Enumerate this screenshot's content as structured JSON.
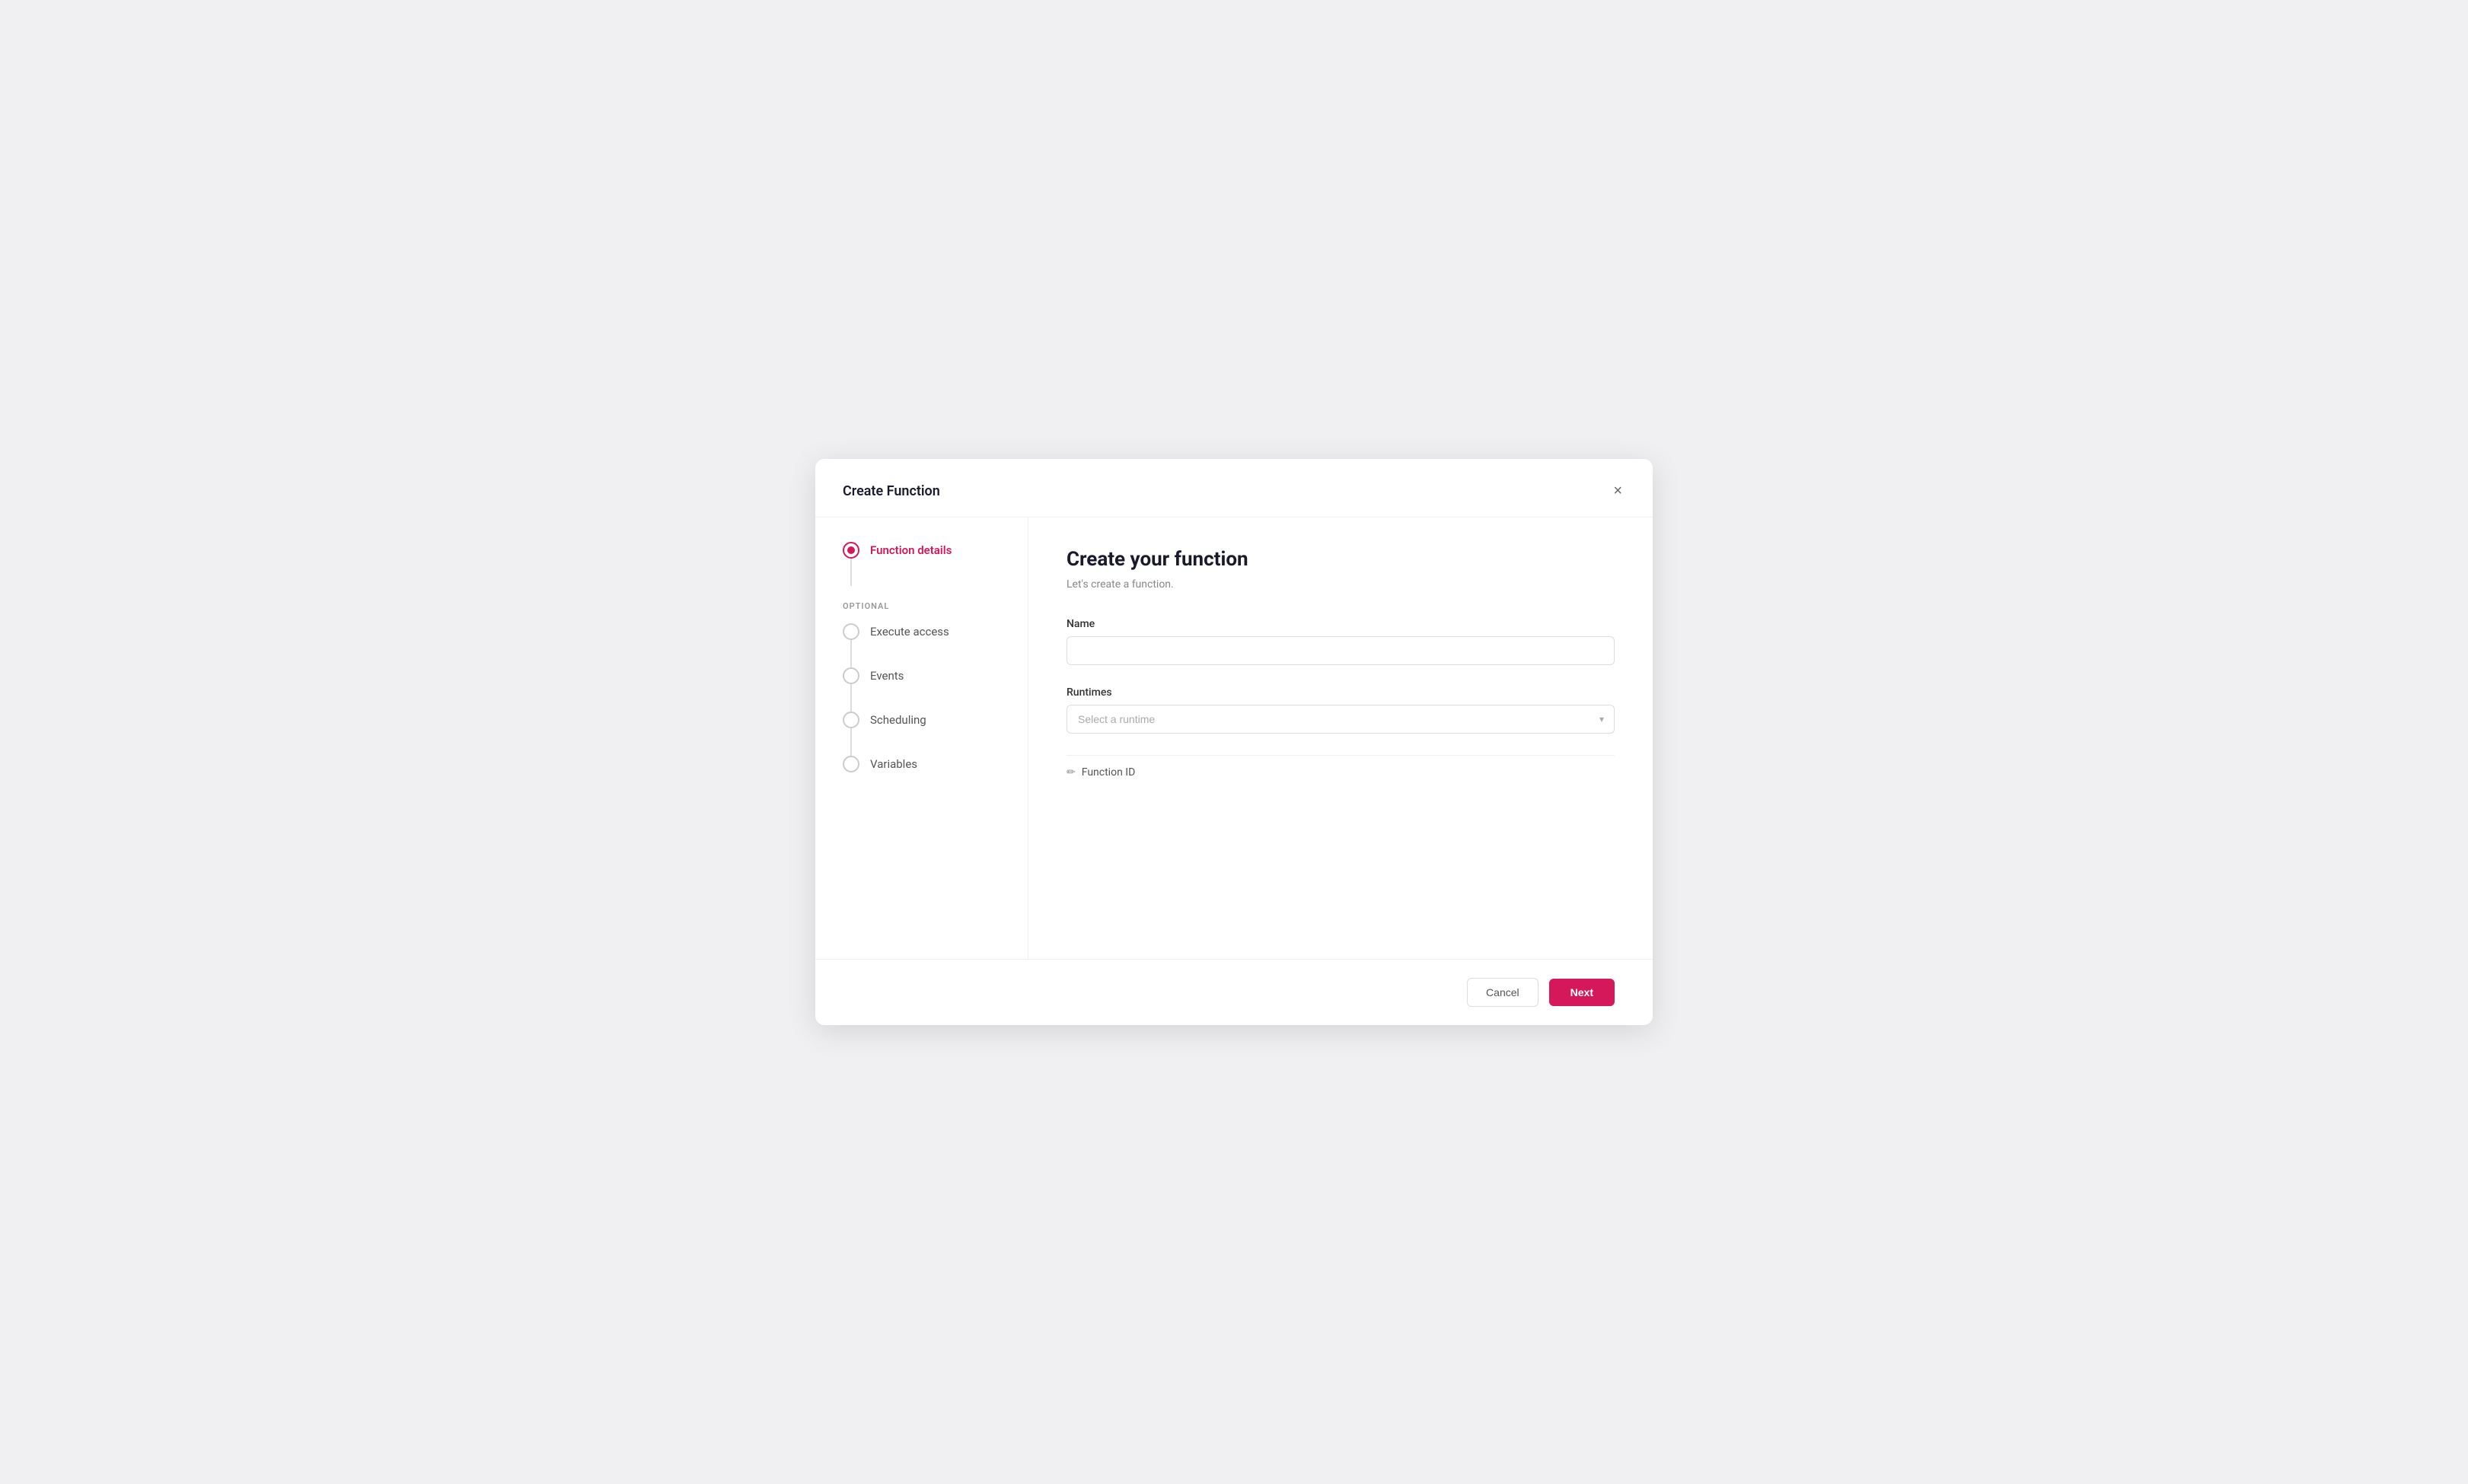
{
  "modal": {
    "title": "Create Function",
    "close_label": "×"
  },
  "sidebar": {
    "active_step": {
      "label": "Function details"
    },
    "optional_label": "OPTIONAL",
    "optional_steps": [
      {
        "label": "Execute access"
      },
      {
        "label": "Events"
      },
      {
        "label": "Scheduling"
      },
      {
        "label": "Variables"
      }
    ]
  },
  "form": {
    "title": "Create your function",
    "subtitle": "Let's create a function.",
    "name_label": "Name",
    "name_placeholder": "",
    "runtimes_label": "Runtimes",
    "runtimes_placeholder": "Select a runtime",
    "function_id_label": "Function ID",
    "function_id_icon": "✏"
  },
  "footer": {
    "cancel_label": "Cancel",
    "next_label": "Next"
  }
}
